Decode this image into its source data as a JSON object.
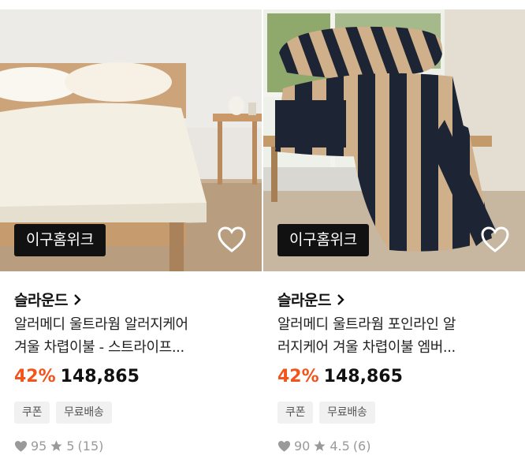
{
  "products": [
    {
      "shop_tag": "이구홈위크",
      "brand": "슬라운드",
      "title_line1": "알러메디 울트라웜 알러지케어",
      "title_line2": "겨울 차렵이불 - 스트라이프...",
      "discount": "42%",
      "price": "148,865",
      "badges": [
        "쿠폰",
        "무료배송"
      ],
      "likes": "95",
      "rating": "5",
      "review_count": "(15)"
    },
    {
      "shop_tag": "이구홈위크",
      "brand": "슬라운드",
      "title_line1": "알러메디 울트라웜 포인라인 알",
      "title_line2": "러지케어 겨울 차렵이불 엠버...",
      "discount": "42%",
      "price": "148,865",
      "badges": [
        "쿠폰",
        "무료배송"
      ],
      "likes": "90",
      "rating": "4.5",
      "review_count": "(6)"
    }
  ],
  "colors": {
    "discount": "#f2541b",
    "tag_bg": "#111111",
    "badge_bg": "#f1f1f1",
    "stat_gray": "#9a9a9a"
  }
}
